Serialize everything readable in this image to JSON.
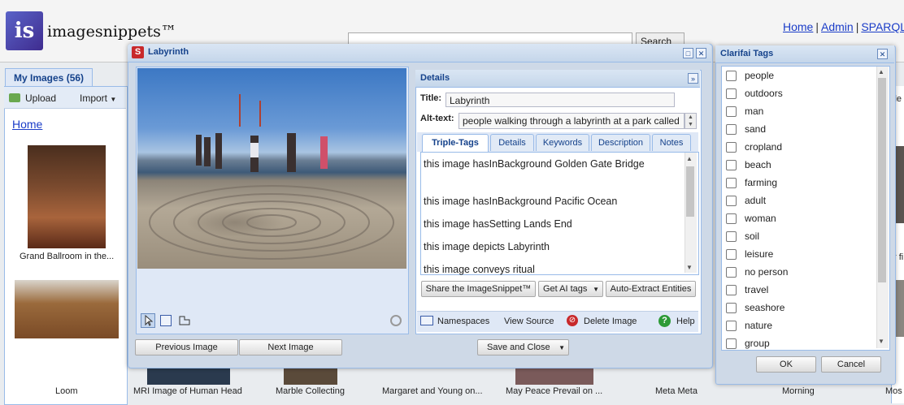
{
  "app": {
    "logo_letters": "is",
    "name": "imagesnippets™",
    "nav_links": [
      "Home",
      "Admin",
      "SPARQL S"
    ],
    "search_button": "Search"
  },
  "left": {
    "tab_label": "My Images (56)",
    "upload_label": "Upload",
    "import_label": "Import",
    "home_link": "Home",
    "thumb_captions": [
      "Grand Ballroom in the..."
    ],
    "right_edge_texts": [
      "ile",
      "r fi"
    ]
  },
  "bottom_captions": [
    "Loom",
    "MRI Image of Human Head",
    "Marble Collecting",
    "Margaret and Young on...",
    "May Peace Prevail on ...",
    "Meta Meta",
    "Morning",
    "Mos"
  ],
  "dialog": {
    "title": "Labyrinth",
    "title_icon": "S",
    "details_header": "Details",
    "title_label": "Title:",
    "title_value": "Labyrinth",
    "alt_label": "Alt-text:",
    "alt_value": "people walking through a labyrinth at a park called",
    "tabs": [
      "Triple-Tags",
      "Details",
      "Keywords",
      "Description",
      "Notes"
    ],
    "triples": [
      "this image hasInBackground Golden Gate Bridge",
      "this image hasInBackground Pacific Ocean",
      "this image hasSetting Lands End",
      "this image depicts Labyrinth",
      "this image conveys ritual"
    ],
    "share_button": "Share the ImageSnippet™",
    "ai_tags_button": "Get AI tags",
    "auto_extract_button": "Auto-Extract Entities",
    "namespaces": "Namespaces",
    "view_source": "View Source",
    "delete_image": "Delete Image",
    "help": "Help",
    "prev_button": "Previous Image",
    "next_button": "Next Image",
    "save_close_button": "Save and Close"
  },
  "clarifai": {
    "title": "Clarifai Tags",
    "tags": [
      "people",
      "outdoors",
      "man",
      "sand",
      "cropland",
      "beach",
      "farming",
      "adult",
      "woman",
      "soil",
      "leisure",
      "no person",
      "travel",
      "seashore",
      "nature",
      "group"
    ],
    "ok_button": "OK",
    "cancel_button": "Cancel"
  }
}
